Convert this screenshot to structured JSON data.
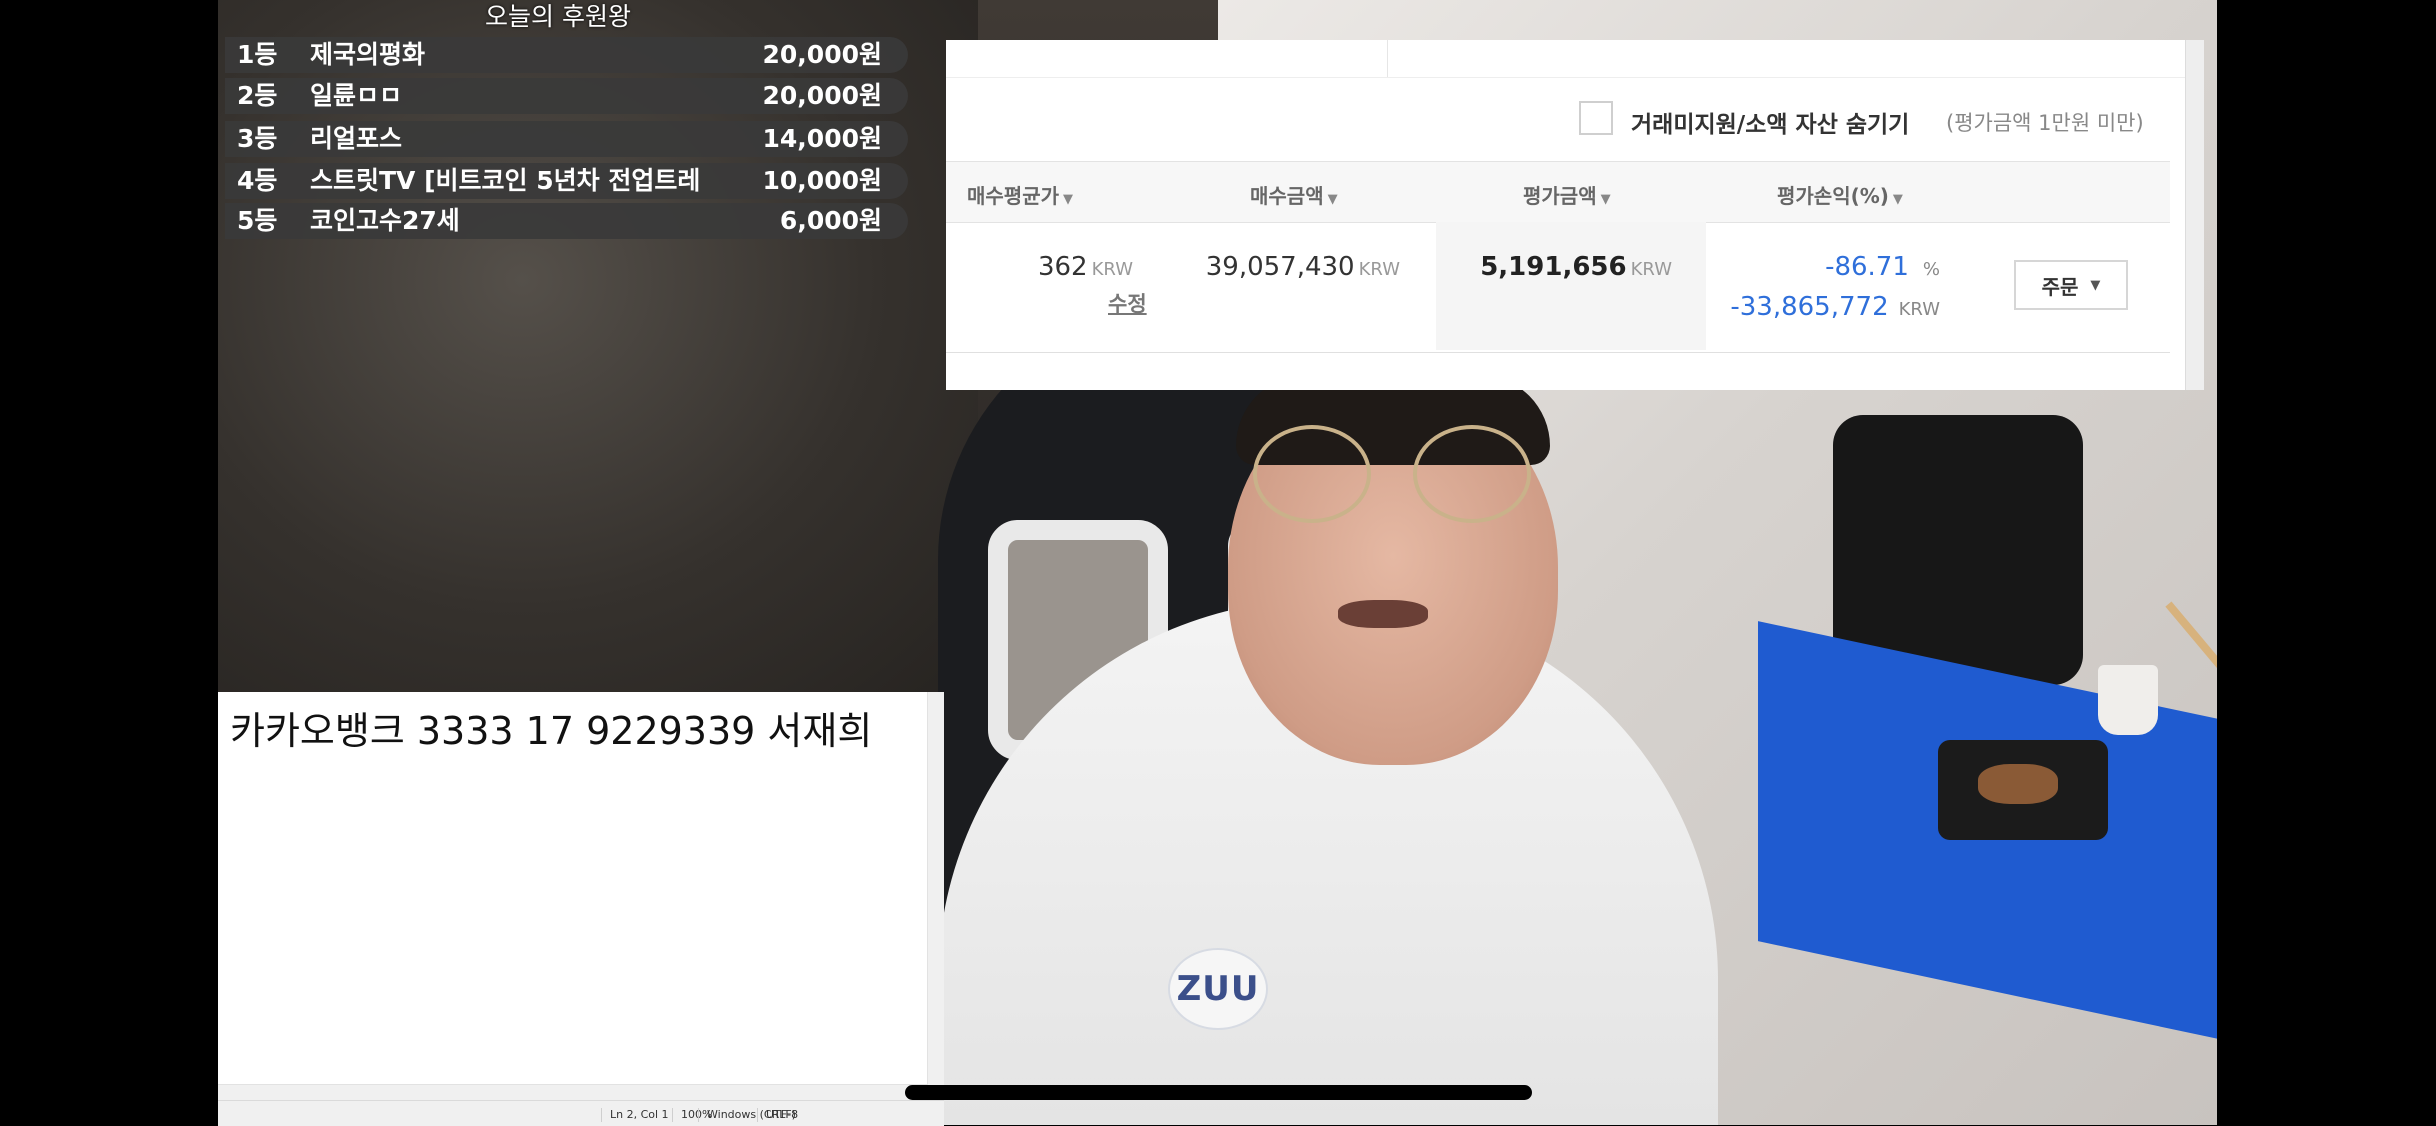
{
  "donation_board": {
    "title": "오늘의 후원왕",
    "ranks": [
      {
        "rank": "1등",
        "name": "제국의평화",
        "amount": "20,000원"
      },
      {
        "rank": "2등",
        "name": "일륜ㅁㅁ",
        "amount": "20,000원"
      },
      {
        "rank": "3등",
        "name": "리얼포스",
        "amount": "14,000원"
      },
      {
        "rank": "4등",
        "name": "스트릿TV [비트코인 5년차 전업트레",
        "amount": "10,000원"
      },
      {
        "rank": "5등",
        "name": "코인고수27세",
        "amount": "6,000원"
      }
    ]
  },
  "trade_panel": {
    "hide_small_assets_label": "거래미지원/소액 자산 숨기기",
    "hide_small_assets_sub": "(평가금액 1만원 미만)",
    "columns": [
      "매수평균가",
      "매수금액",
      "평가금액",
      "평가손익(%)"
    ],
    "row": {
      "avg_price": "362",
      "avg_price_unit": "KRW",
      "edit_label": "수정",
      "buy_amount": "39,057,430",
      "buy_amount_unit": "KRW",
      "eval_amount": "5,191,656",
      "eval_amount_unit": "KRW",
      "pl_percent": "-86.71",
      "pl_percent_unit": "%",
      "pl_amount": "-33,865,772",
      "pl_amount_unit": "KRW"
    },
    "order_button": "주문",
    "loss_color": "#2f6fda"
  },
  "notepad": {
    "content": "카카오뱅크 3333 17 9229339 서재희",
    "status": {
      "position": "Ln 2, Col 1",
      "zoom": "100%",
      "line_ending": "Windows (CRLF)",
      "encoding": "UTF-8"
    }
  },
  "stream": {
    "shirt_logo": "ZUU"
  },
  "icons": {
    "sort": "caret-down-icon",
    "dropdown": "caret-down-icon"
  }
}
